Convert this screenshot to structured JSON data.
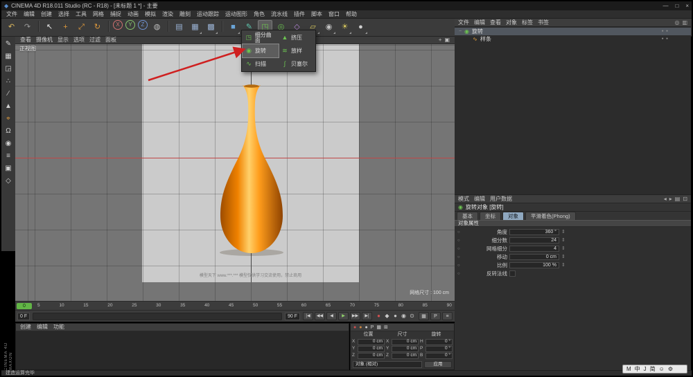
{
  "colors": {
    "arrow_red": "#cf2020",
    "timeline_green": "#62b546",
    "tab_selected": "#8fa8c0",
    "vase_dark": "#9e4d00",
    "vase_mid": "#ff9d1c",
    "vase_light": "#ffd06a"
  },
  "window": {
    "app_icon": "◆",
    "title": "CINEMA 4D R18.011 Studio (RC - R18) - [未标题 1 *] - 主要",
    "minimize": "—",
    "maximize": "□",
    "close": "×",
    "status_text": "建造运算完毕",
    "brand_vertical_1": "CINEMA 4D",
    "brand_vertical_2": "MAXON"
  },
  "menubar": {
    "items": [
      "文件",
      "编辑",
      "创建",
      "选择",
      "工具",
      "网格",
      "捕捉",
      "动画",
      "模拟",
      "渲染",
      "雕刻",
      "运动跟踪",
      "运动图形",
      "角色",
      "流水线",
      "插件",
      "脚本",
      "窗口",
      "帮助"
    ]
  },
  "toolbar": {
    "icons": [
      {
        "g": "↶",
        "c": "#d9b65e",
        "cls": ""
      },
      {
        "g": "↷",
        "c": "#9a9a9a",
        "cls": ""
      },
      {
        "g": "",
        "c": "",
        "cls": "tb-sep"
      },
      {
        "g": "↖",
        "c": "#e8e8e8",
        "cls": ""
      },
      {
        "g": "+",
        "c": "#e09a3c",
        "cls": ""
      },
      {
        "g": "⤢",
        "c": "#e09a3c",
        "cls": ""
      },
      {
        "g": "↻",
        "c": "#e09a3c",
        "cls": ""
      },
      {
        "g": "",
        "c": "",
        "cls": "tb-sep"
      },
      {
        "g": "X",
        "c": "#d07070",
        "cls": "circle"
      },
      {
        "g": "Y",
        "c": "#86c46e",
        "cls": "circle"
      },
      {
        "g": "Z",
        "c": "#7092d0",
        "cls": "circle"
      },
      {
        "g": "◍",
        "c": "#bdbdbd",
        "cls": ""
      },
      {
        "g": "",
        "c": "",
        "cls": "tb-sep"
      },
      {
        "g": "▤",
        "c": "#9ab2d4",
        "cls": ""
      },
      {
        "g": "▦",
        "c": "#9ab2d4",
        "cls": "dd"
      },
      {
        "g": "▩",
        "c": "#9ab2d4",
        "cls": "dd"
      },
      {
        "g": "",
        "c": "",
        "cls": "tb-sep"
      },
      {
        "g": "■",
        "c": "#6aa5d8",
        "cls": "dd"
      },
      {
        "g": "✎",
        "c": "#5fc9b0",
        "cls": "dd"
      },
      {
        "g": "◳",
        "c": "#6cc251",
        "cls": "dd pressed"
      },
      {
        "g": "◎",
        "c": "#6cc251",
        "cls": "dd"
      },
      {
        "g": "◇",
        "c": "#b586d6",
        "cls": "dd"
      },
      {
        "g": "▱",
        "c": "#d9c95e",
        "cls": "dd"
      },
      {
        "g": "◉",
        "c": "#c0c0c0",
        "cls": "dd"
      },
      {
        "g": "☀",
        "c": "#d9c95e",
        "cls": "dd"
      },
      {
        "g": "●",
        "c": "#d0d0d0",
        "cls": "dd"
      }
    ],
    "right_icons": [
      {
        "g": "◎"
      },
      {
        "g": "▦"
      },
      {
        "g": "▥"
      }
    ]
  },
  "left_toolbar": {
    "icons": [
      {
        "g": "✎",
        "c": "#cfcfcf"
      },
      {
        "g": "▦",
        "c": "#cfcfcf"
      },
      {
        "g": "◲",
        "c": "#cfcfcf"
      },
      {
        "g": "∴",
        "c": "#cfcfcf"
      },
      {
        "g": "∕",
        "c": "#cfcfcf"
      },
      {
        "g": "▲",
        "c": "#cfcfcf"
      },
      {
        "g": "⌖",
        "c": "#e09a3c"
      },
      {
        "g": "Ω",
        "c": "#cfcfcf"
      },
      {
        "g": "◉",
        "c": "#cfcfcf"
      },
      {
        "g": "≡",
        "c": "#cfcfcf"
      },
      {
        "g": "▣",
        "c": "#cfcfcf"
      },
      {
        "g": "◇",
        "c": "#cfcfcf"
      }
    ]
  },
  "generator_menu": {
    "items": [
      {
        "icon": "◳",
        "label": "细分曲面",
        "cls": ""
      },
      {
        "icon": "◉",
        "label": "旋转",
        "cls": "selected"
      },
      {
        "icon": "∿",
        "label": "扫描",
        "cls": ""
      },
      {
        "icon": "▲",
        "label": "挤压",
        "cls": ""
      },
      {
        "icon": "≋",
        "label": "放样",
        "cls": ""
      },
      {
        "icon": "∫",
        "label": "贝塞尔",
        "cls": ""
      }
    ]
  },
  "viewport": {
    "menus": [
      "查看",
      "摄像机",
      "显示",
      "选项",
      "过滤",
      "面板"
    ],
    "right_icons": [
      {
        "g": "+"
      },
      {
        "g": "▣"
      }
    ],
    "label": "正视图",
    "watermark": "模型天下 www.***.*** 模型仅供学习交流使用，禁止商用",
    "grid_size_label": "网格尺寸 : 100 cm"
  },
  "timeline": {
    "marker": "0",
    "ticks": [
      "5",
      "10",
      "15",
      "20",
      "25",
      "30",
      "35",
      "40",
      "45",
      "50",
      "55",
      "60",
      "65",
      "70",
      "75",
      "80",
      "85",
      "90"
    ]
  },
  "transport": {
    "current_frame": "0 F",
    "end_frame": "90 F",
    "buttons": [
      {
        "g": "|◀",
        "cls": ""
      },
      {
        "g": "◀◀",
        "cls": ""
      },
      {
        "g": "◀",
        "cls": ""
      },
      {
        "g": "▶",
        "cls": "play"
      },
      {
        "g": "▶▶",
        "cls": ""
      },
      {
        "g": "▶|",
        "cls": ""
      }
    ],
    "record_icons": [
      {
        "g": "●",
        "c": "#cf5050"
      },
      {
        "g": "◆",
        "c": "#c9c9c9"
      },
      {
        "g": "●",
        "c": "#c9c9c9"
      },
      {
        "g": "◉",
        "c": "#c9c9c9"
      },
      {
        "g": "⊙",
        "c": "#c9c9c9"
      }
    ],
    "right_icons": [
      {
        "g": "▦"
      },
      {
        "g": "P"
      },
      {
        "g": "≡"
      }
    ]
  },
  "materials": {
    "menus": [
      "创建",
      "编辑",
      "功能"
    ]
  },
  "coords": {
    "header_icons": [
      {
        "g": "●",
        "c": "#cf5050"
      },
      {
        "g": "●",
        "c": "#d0883f"
      },
      {
        "g": "●",
        "c": "#cfcfcf"
      },
      {
        "g": "P",
        "c": "#cfcfcf"
      },
      {
        "g": "▦",
        "c": "#cfcfcf"
      },
      {
        "g": "⊞",
        "c": "#cfcfcf"
      }
    ],
    "position": {
      "title": "位置",
      "rows": [
        {
          "axis": "X",
          "value": "0 cm"
        },
        {
          "axis": "Y",
          "value": "0 cm"
        },
        {
          "axis": "Z",
          "value": "0 cm"
        }
      ]
    },
    "size": {
      "title": "尺寸",
      "rows": [
        {
          "axis": "X",
          "value": "0 cm"
        },
        {
          "axis": "Y",
          "value": "0 cm"
        },
        {
          "axis": "Z",
          "value": "0 cm"
        }
      ]
    },
    "rotation": {
      "title": "旋转",
      "rows": [
        {
          "axis": "H",
          "value": "0 °"
        },
        {
          "axis": "P",
          "value": "0 °"
        },
        {
          "axis": "B",
          "value": "0 °"
        }
      ]
    },
    "mode_dropdown": "对象 (相对)",
    "apply_button": "应用"
  },
  "object_manager": {
    "menus": [
      "文件",
      "编辑",
      "查看",
      "对象",
      "标签",
      "书签"
    ],
    "right_icons": [
      {
        "g": "◎"
      },
      {
        "g": "▥"
      }
    ],
    "objects": [
      {
        "expander": "−",
        "icon": "◉",
        "icon_color": "#6cc251",
        "name": "旋转",
        "cls": "selected",
        "dots": "● ●"
      },
      {
        "expander": "",
        "icon": "∿",
        "icon_color": "#e8a33d",
        "name": "样条",
        "cls": "child",
        "dots": "● ●"
      }
    ]
  },
  "attributes": {
    "menus": [
      "模式",
      "编辑",
      "用户数据"
    ],
    "right_icons": [
      {
        "g": "◂"
      },
      {
        "g": "▸"
      },
      {
        "g": "▤"
      },
      {
        "g": "⊡"
      }
    ],
    "object_icon": "◉",
    "title": "旋转对象 [旋转]",
    "tabs": [
      {
        "label": "基本",
        "cls": ""
      },
      {
        "label": "坐标",
        "cls": ""
      },
      {
        "label": "对象",
        "cls": "selected"
      },
      {
        "label": "平滑着色(Phong)",
        "cls": ""
      }
    ],
    "section": "对象属性",
    "rows": [
      {
        "label": "角度",
        "value": "360 °",
        "cls": ""
      },
      {
        "label": "细分数",
        "value": "24",
        "cls": ""
      },
      {
        "label": "网格细分",
        "value": "4",
        "cls": ""
      },
      {
        "label": "移动",
        "value": "0 cm",
        "cls": ""
      },
      {
        "label": "比例",
        "value": "100 %",
        "cls": ""
      },
      {
        "label": "反转法线",
        "value": "",
        "cls": "checkbox"
      }
    ]
  },
  "ime": {
    "segments": [
      "M",
      "中",
      "J",
      "简",
      "☺",
      "⚙"
    ]
  }
}
